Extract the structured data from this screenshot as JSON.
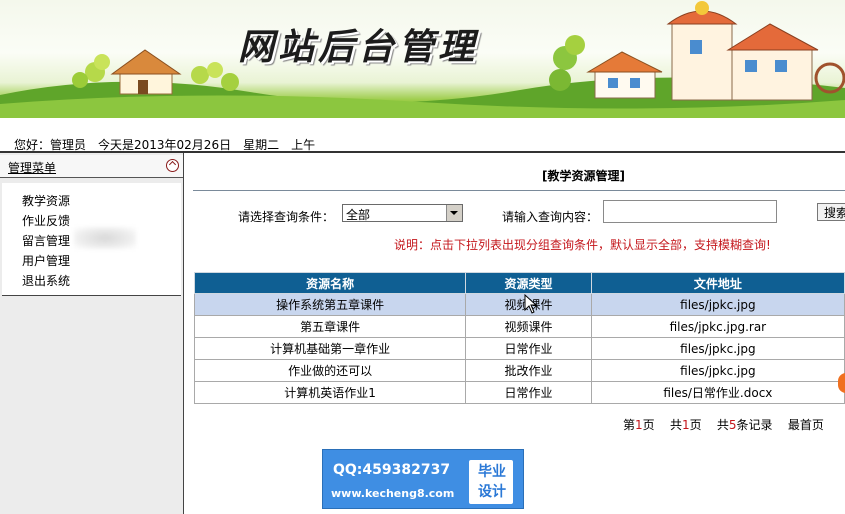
{
  "banner": {
    "title": "网站后台管理"
  },
  "greeting": "您好：管理员　今天是2013年02月26日　星期二　上午",
  "sidebar": {
    "title": "管理菜单",
    "items": [
      {
        "label": "教学资源"
      },
      {
        "label": "作业反馈"
      },
      {
        "label": "留言管理"
      },
      {
        "label": "用户管理"
      },
      {
        "label": "退出系统"
      }
    ]
  },
  "main": {
    "title": "[教学资源管理]",
    "query_label": "请选择查询条件：",
    "query_selected": "全部",
    "content_label": "请输入查询内容：",
    "content_value": "",
    "search_label": "搜索",
    "hint": "说明：点击下拉列表出现分组查询条件，默认显示全部，支持模糊查询!"
  },
  "table": {
    "columns": [
      "资源名称",
      "资源类型",
      "文件地址"
    ],
    "rows": [
      [
        "操作系统第五章课件",
        "视频课件",
        "files/jpkc.jpg"
      ],
      [
        "第五章课件",
        "视频课件",
        "files/jpkc.jpg.rar"
      ],
      [
        "计算机基础第一章作业",
        "日常作业",
        "files/jpkc.jpg"
      ],
      [
        "作业做的还可以",
        "批改作业",
        "files/jpkc.jpg"
      ],
      [
        "计算机英语作业1",
        "日常作业",
        "files/日常作业.docx"
      ]
    ]
  },
  "pager": {
    "page_prefix": "第",
    "page_num": "1",
    "page_suffix": "页",
    "total_prefix": "共",
    "total_num": "1",
    "total_suffix": "页",
    "records_prefix": "共",
    "records_num": "5",
    "records_suffix": "条记录",
    "first_label": "最首页"
  },
  "watermark": {
    "qq": "QQ:459382737",
    "url": "www.kecheng8.com",
    "badge_line1": "毕业",
    "badge_line2": "设计"
  },
  "colors": {
    "table_header": "#0f5f93",
    "selected_row": "#c8d6ee",
    "hint": "#c4171c",
    "watermark": "#3f8ee3"
  }
}
